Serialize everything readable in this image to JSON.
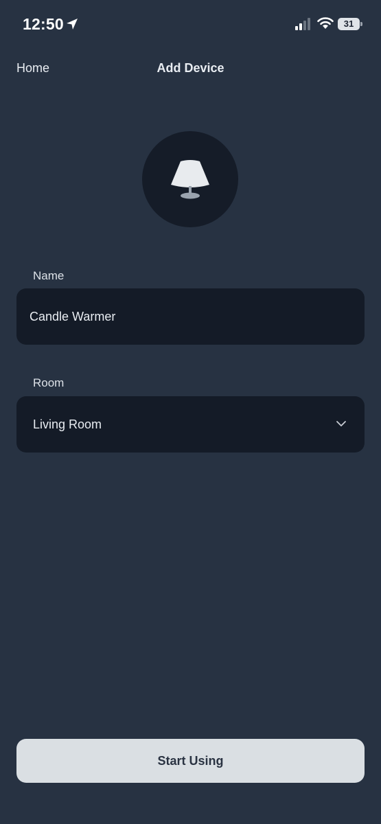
{
  "status_bar": {
    "time": "12:50",
    "battery": "31",
    "icons": [
      "location-arrow-icon",
      "cellular-signal-icon",
      "wifi-icon",
      "battery-icon"
    ]
  },
  "nav": {
    "back_label": "Home",
    "title": "Add Device"
  },
  "device": {
    "icon": "lamp-icon"
  },
  "form": {
    "name": {
      "label": "Name",
      "value": "Candle Warmer"
    },
    "room": {
      "label": "Room",
      "selected": "Living Room"
    }
  },
  "actions": {
    "start_label": "Start Using"
  },
  "colors": {
    "background": "#273242",
    "field_background": "#141b27",
    "button_background": "#dadfe3",
    "text": "#e9edf2"
  }
}
